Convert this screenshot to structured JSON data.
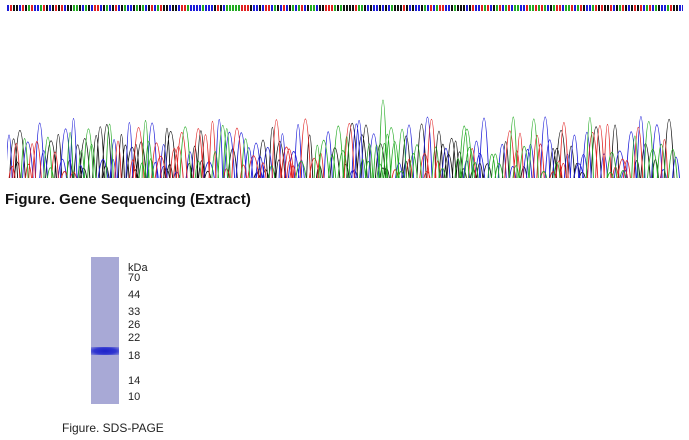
{
  "sequencing": {
    "caption": "Figure. Gene Sequencing (Extract)",
    "channel_colors": {
      "A": "#22aa22",
      "C": "#1c1cd8",
      "G": "#111111",
      "T": "#e02020"
    }
  },
  "sds_page": {
    "unit_label": "kDa",
    "markers": [
      "70",
      "44",
      "33",
      "26",
      "22",
      "18",
      "14",
      "10"
    ],
    "caption": "Figure. SDS-PAGE",
    "lane_color": "#a8a9d6",
    "band_color": "#2328c8"
  }
}
